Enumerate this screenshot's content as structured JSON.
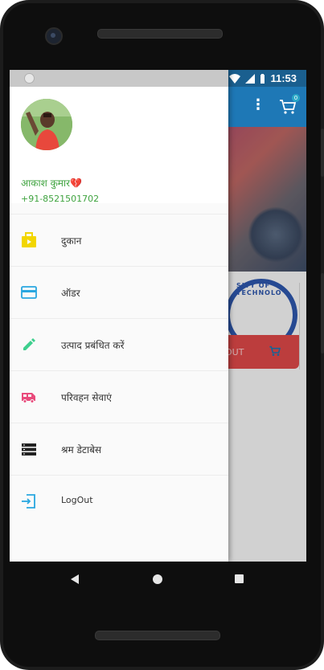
{
  "status_bar": {
    "time": "11:53"
  },
  "background_app": {
    "cart_badge": "0",
    "banner_text": "SITY OF TECHNOLO",
    "card_button_label": "OUT"
  },
  "drawer": {
    "user": {
      "name": "आकाश कुमार",
      "heart": "💔",
      "phone": "+91-8521501702"
    },
    "items": [
      {
        "label": "दुकान",
        "icon": "shop-bag-icon",
        "color": "#f2d600"
      },
      {
        "label": "ऑडर",
        "icon": "credit-card-icon",
        "color": "#29a7e0"
      },
      {
        "label": "उत्पाद प्रबंधित करें",
        "icon": "pencil-icon",
        "color": "#3ecf8e"
      },
      {
        "label": "परिवहन सेवाएं",
        "icon": "bus-icon",
        "color": "#e94b7c"
      },
      {
        "label": "श्रम डेटाबेस",
        "icon": "database-list-icon",
        "color": "#222222"
      },
      {
        "label": "LogOut",
        "icon": "logout-icon",
        "color": "#29a7e0"
      }
    ]
  },
  "colors": {
    "app_bar": "#1e78b6",
    "accent_green": "#3fa33f",
    "cart_button": "#e64b4b"
  }
}
